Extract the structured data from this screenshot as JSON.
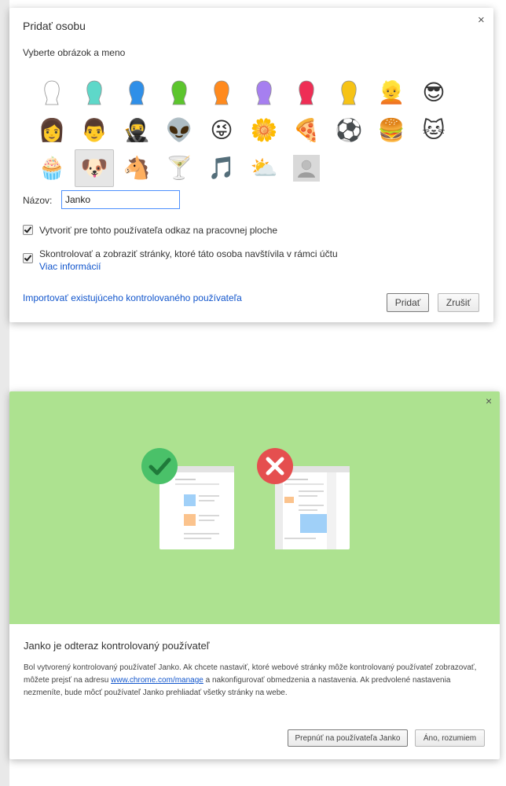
{
  "add_person_dialog": {
    "title": "Pridať osobu",
    "subtitle": "Vyberte obrázok a meno",
    "close_symbol": "×",
    "avatars": [
      {
        "icon": "silhouette-white-icon",
        "color": "#ffffff"
      },
      {
        "icon": "silhouette-teal-icon",
        "color": "#5ed8c9"
      },
      {
        "icon": "silhouette-blue-icon",
        "color": "#2f8fe8"
      },
      {
        "icon": "silhouette-green-icon",
        "color": "#5cc52d"
      },
      {
        "icon": "silhouette-orange-icon",
        "color": "#ff8a1e"
      },
      {
        "icon": "silhouette-purple-icon",
        "color": "#a67ff0"
      },
      {
        "icon": "silhouette-red-icon",
        "color": "#ee2e55"
      },
      {
        "icon": "silhouette-yellow-icon",
        "color": "#f6c316"
      },
      {
        "icon": "blonde-woman-icon",
        "glyph": "👱"
      },
      {
        "icon": "sunglasses-man-icon",
        "glyph": "😎"
      },
      {
        "icon": "woman-sunglasses-icon",
        "glyph": "👩"
      },
      {
        "icon": "man-icon",
        "glyph": "👨"
      },
      {
        "icon": "ninja-icon",
        "glyph": "🥷"
      },
      {
        "icon": "alien-icon",
        "glyph": "👽"
      },
      {
        "icon": "laughing-face-icon",
        "glyph": "😜"
      },
      {
        "icon": "flower-icon",
        "glyph": "🌼"
      },
      {
        "icon": "pizza-icon",
        "glyph": "🍕"
      },
      {
        "icon": "soccer-ball-icon",
        "glyph": "⚽"
      },
      {
        "icon": "burger-icon",
        "glyph": "🍔"
      },
      {
        "icon": "cat-icon",
        "glyph": "🐱"
      },
      {
        "icon": "cupcake-icon",
        "glyph": "🧁"
      },
      {
        "icon": "dog-icon",
        "glyph": "🐶",
        "selected": true
      },
      {
        "icon": "horse-icon",
        "glyph": "🐴"
      },
      {
        "icon": "cocktail-icon",
        "glyph": "🍸"
      },
      {
        "icon": "music-note-icon",
        "glyph": "🎵"
      },
      {
        "icon": "cloud-sun-icon",
        "glyph": "⛅"
      },
      {
        "icon": "generic-user-icon",
        "color": "#bdbdbd"
      }
    ],
    "name_label": "Názov:",
    "name_value": "Janko",
    "create_shortcut_label": "Vytvoriť pre tohto používateľa odkaz na pracovnej ploche",
    "create_shortcut_checked": true,
    "supervise_label": "Skontrolovať a zobraziť stránky, ktoré táto osoba navštívila v rámci účtu",
    "supervise_checked": true,
    "more_info_link": "Viac informácií",
    "import_link": "Importovať existujúceho kontrolovaného používateľa",
    "add_button": "Pridať",
    "cancel_button": "Zrušiť"
  },
  "confirmation_dialog": {
    "close_symbol": "×",
    "hero_bg_color": "#ade290",
    "title": "Janko je odteraz kontrolovaný používateľ",
    "desc_part1": "Bol vytvorený kontrolovaný používateľ Janko. Ak chcete nastaviť, ktoré webové stránky môže kontrolovaný používateľ zobrazovať, môžete prejsť na adresu ",
    "desc_link": "www.chrome.com/manage",
    "desc_part2": " a nakonfigurovať obmedzenia a nastavenia. Ak predvolené nastavenia nezmeníte, bude môcť používateľ Janko prehliadať všetky stránky na webe.",
    "switch_button": "Prepnúť na používateľa Janko",
    "ok_button": "Áno, rozumiem",
    "allowed_badge_color": "#4ac169",
    "blocked_badge_color": "#e54f4f"
  }
}
